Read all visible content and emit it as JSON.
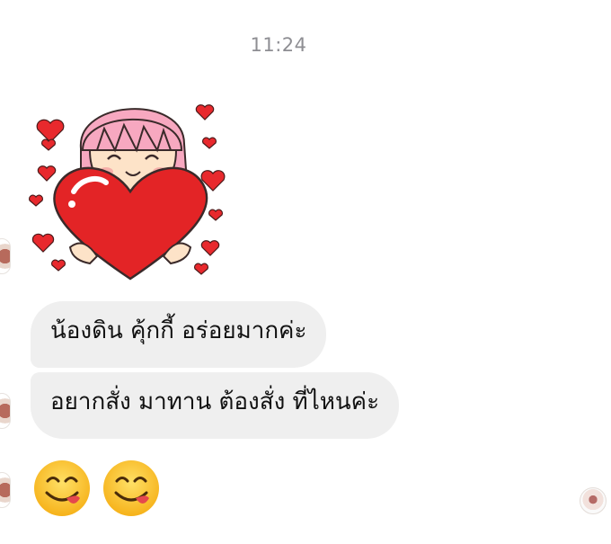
{
  "chat": {
    "timestamp": "11:24",
    "messages": [
      {
        "type": "sticker",
        "sticker": "girl-holding-heart-sticker"
      },
      {
        "type": "text",
        "text": "น้องดิน คุ้กกี้ อร่อยมากค่ะ"
      },
      {
        "type": "text",
        "text": "อยากสั่ง มาทาน ต้องสั่ง ที่ไหนค่ะ"
      },
      {
        "type": "emoji",
        "emoji": [
          "😋",
          "😋"
        ]
      }
    ]
  },
  "colors": {
    "bubble": "#efefef",
    "timestamp": "#8e8e93",
    "heart": "#e8292d",
    "hair": "#f7a8c0"
  },
  "icons": [
    "yum-face-emoji",
    "seen-avatar",
    "sender-avatar"
  ]
}
